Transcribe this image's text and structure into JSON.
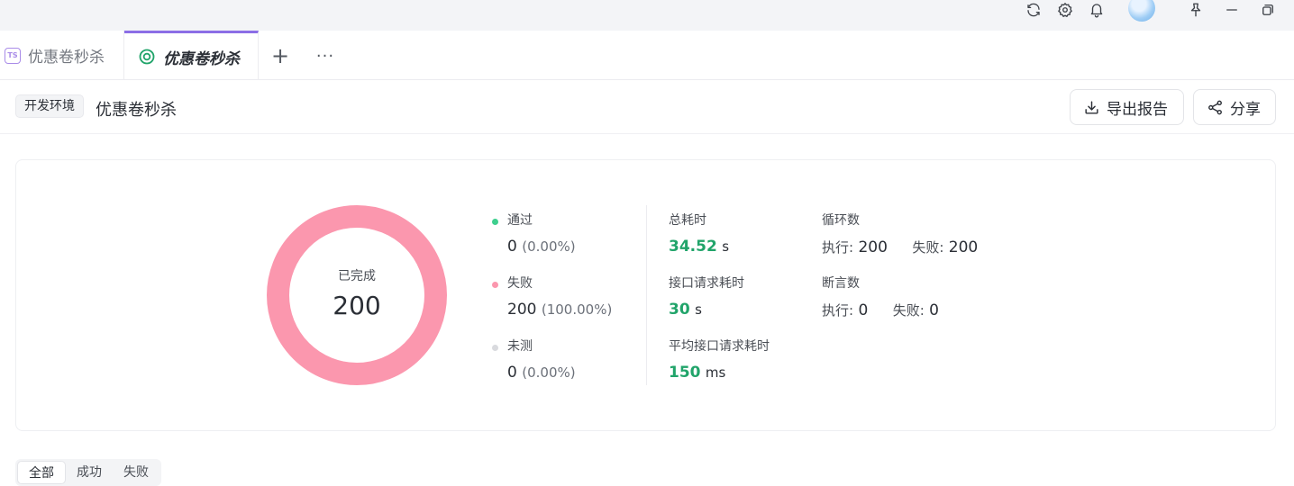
{
  "topbar": {
    "icons": [
      "refresh-icon",
      "gear-icon",
      "bell-icon",
      "avatar",
      "pin-icon",
      "minimize-icon",
      "restore-icon"
    ]
  },
  "tabs": [
    {
      "label": "优惠卷秒杀",
      "icon": "ts-file-icon",
      "active": false
    },
    {
      "label": "优惠卷秒杀",
      "icon": "scenario-icon",
      "active": true
    }
  ],
  "tab_actions": {
    "add": "+",
    "more": "···"
  },
  "header": {
    "env_badge": "开发环境",
    "title": "优惠卷秒杀",
    "export_label": "导出报告",
    "share_label": "分享"
  },
  "summary": {
    "donut_label": "已完成",
    "donut_value": "200",
    "donut_color": "#fb97ae",
    "legend": [
      {
        "name": "通过",
        "count": "0",
        "percent": "(0.00%)",
        "color": "#3ecf8e"
      },
      {
        "name": "失败",
        "count": "200",
        "percent": "(100.00%)",
        "color": "#fb97ae"
      },
      {
        "name": "未测",
        "count": "0",
        "percent": "(0.00%)",
        "color": "#d9dade"
      }
    ],
    "total_time": {
      "label": "总耗时",
      "value": "34.52",
      "unit": "s"
    },
    "api_time": {
      "label": "接口请求耗时",
      "value": "30",
      "unit": "s"
    },
    "avg_time": {
      "label": "平均接口请求耗时",
      "value": "150",
      "unit": "ms"
    },
    "loops": {
      "label": "循环数",
      "exec_label": "执行:",
      "exec_value": "200",
      "fail_label": "失败:",
      "fail_value": "200"
    },
    "assertions": {
      "label": "断言数",
      "exec_label": "执行:",
      "exec_value": "0",
      "fail_label": "失败:",
      "fail_value": "0"
    }
  },
  "filter_tabs": [
    "全部",
    "成功",
    "失败"
  ]
}
